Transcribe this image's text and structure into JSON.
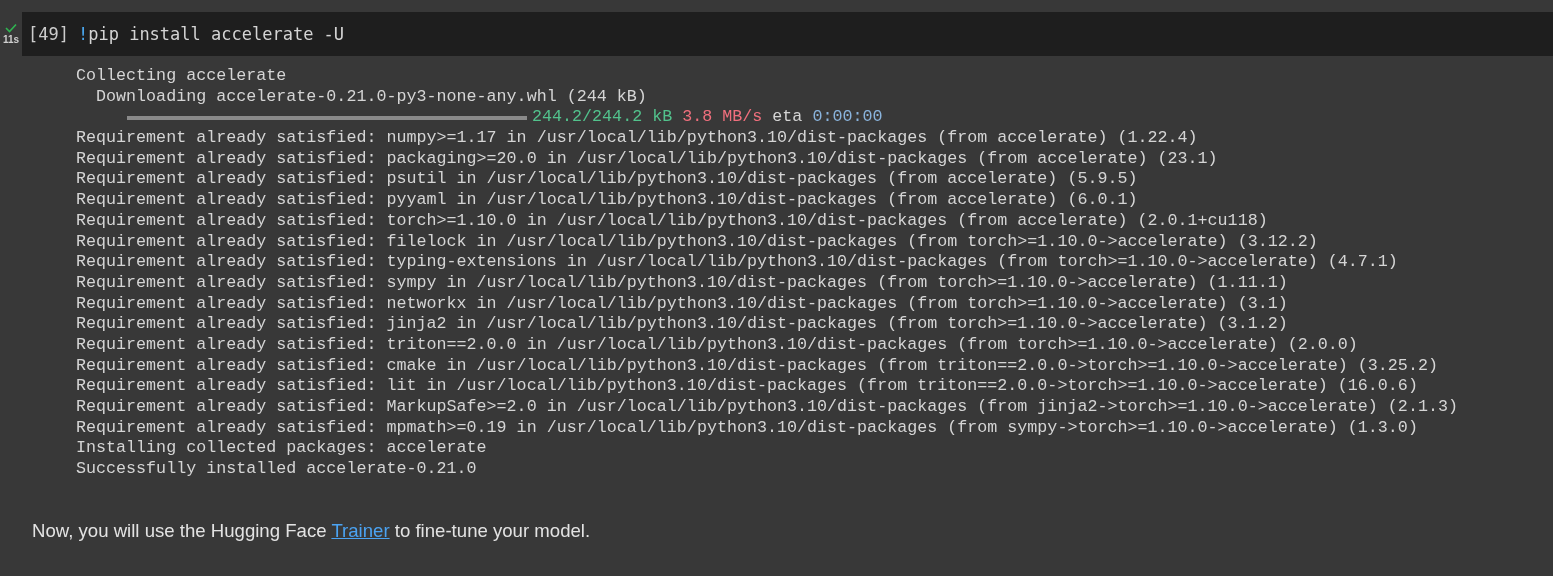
{
  "cell": {
    "succeeded": true,
    "run_time": "11s",
    "execution_count": "[49]",
    "code_prefix": "!",
    "code": "pip install accelerate -U"
  },
  "output": [
    {
      "kind": "text",
      "text": "Collecting accelerate"
    },
    {
      "kind": "text",
      "text": "  Downloading accelerate-0.21.0-py3-none-any.whl (244 kB)"
    },
    {
      "kind": "progress",
      "level": 1,
      "size": "244.2/244.2 kB",
      "speed": "3.8 MB/s",
      "eta_label": "eta",
      "eta": "0:00:00"
    },
    {
      "kind": "text",
      "text": "Requirement already satisfied: numpy>=1.17 in /usr/local/lib/python3.10/dist-packages (from accelerate) (1.22.4)"
    },
    {
      "kind": "text",
      "text": "Requirement already satisfied: packaging>=20.0 in /usr/local/lib/python3.10/dist-packages (from accelerate) (23.1)"
    },
    {
      "kind": "text",
      "text": "Requirement already satisfied: psutil in /usr/local/lib/python3.10/dist-packages (from accelerate) (5.9.5)"
    },
    {
      "kind": "text",
      "text": "Requirement already satisfied: pyyaml in /usr/local/lib/python3.10/dist-packages (from accelerate) (6.0.1)"
    },
    {
      "kind": "text",
      "text": "Requirement already satisfied: torch>=1.10.0 in /usr/local/lib/python3.10/dist-packages (from accelerate) (2.0.1+cu118)"
    },
    {
      "kind": "text",
      "text": "Requirement already satisfied: filelock in /usr/local/lib/python3.10/dist-packages (from torch>=1.10.0->accelerate) (3.12.2)"
    },
    {
      "kind": "text",
      "text": "Requirement already satisfied: typing-extensions in /usr/local/lib/python3.10/dist-packages (from torch>=1.10.0->accelerate) (4.7.1)"
    },
    {
      "kind": "text",
      "text": "Requirement already satisfied: sympy in /usr/local/lib/python3.10/dist-packages (from torch>=1.10.0->accelerate) (1.11.1)"
    },
    {
      "kind": "text",
      "text": "Requirement already satisfied: networkx in /usr/local/lib/python3.10/dist-packages (from torch>=1.10.0->accelerate) (3.1)"
    },
    {
      "kind": "text",
      "text": "Requirement already satisfied: jinja2 in /usr/local/lib/python3.10/dist-packages (from torch>=1.10.0->accelerate) (3.1.2)"
    },
    {
      "kind": "text",
      "text": "Requirement already satisfied: triton==2.0.0 in /usr/local/lib/python3.10/dist-packages (from torch>=1.10.0->accelerate) (2.0.0)"
    },
    {
      "kind": "text",
      "text": "Requirement already satisfied: cmake in /usr/local/lib/python3.10/dist-packages (from triton==2.0.0->torch>=1.10.0->accelerate) (3.25.2)"
    },
    {
      "kind": "text",
      "text": "Requirement already satisfied: lit in /usr/local/lib/python3.10/dist-packages (from triton==2.0.0->torch>=1.10.0->accelerate) (16.0.6)"
    },
    {
      "kind": "text",
      "text": "Requirement already satisfied: MarkupSafe>=2.0 in /usr/local/lib/python3.10/dist-packages (from jinja2->torch>=1.10.0->accelerate) (2.1.3)"
    },
    {
      "kind": "text",
      "text": "Requirement already satisfied: mpmath>=0.19 in /usr/local/lib/python3.10/dist-packages (from sympy->torch>=1.10.0->accelerate) (1.3.0)"
    },
    {
      "kind": "text",
      "text": "Installing collected packages: accelerate"
    },
    {
      "kind": "text",
      "text": "Successfully installed accelerate-0.21.0"
    }
  ],
  "markdown": {
    "before": "Now, you will use the Hugging Face ",
    "link": "Trainer",
    "after": " to fine-tune your model."
  }
}
